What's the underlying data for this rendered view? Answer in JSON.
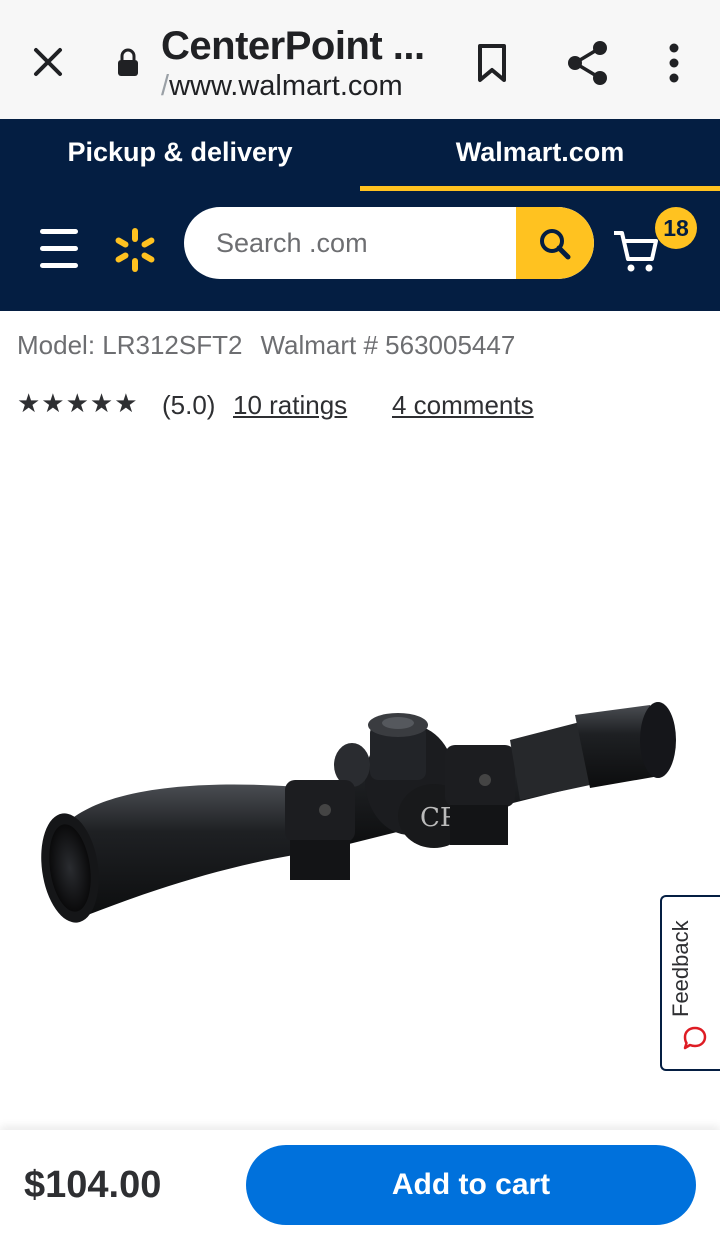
{
  "browser": {
    "title": "CenterPoint ...",
    "url_prefix": "/",
    "url": "www.walmart.com",
    "icons": [
      "close-icon",
      "lock-icon",
      "bookmark-icon",
      "share-icon",
      "more-vert-icon"
    ]
  },
  "tabs": [
    {
      "label": "Pickup & delivery",
      "active": false
    },
    {
      "label": "Walmart.com",
      "active": true
    }
  ],
  "header": {
    "search_placeholder": "Search .com",
    "cart_count": "18",
    "icons": [
      "menu-icon",
      "walmart-spark-icon",
      "search-icon",
      "cart-icon"
    ]
  },
  "product": {
    "model": "Model: LR312SFT2",
    "walmart_number": "Walmart # 563005447",
    "stars": "★★★★★",
    "score": "(5.0)",
    "ratings_link": "10 ratings",
    "comments_link": "4 comments",
    "price": "$104.00",
    "add_to_cart_label": "Add to cart"
  },
  "feedback": {
    "label": "Feedback"
  },
  "colors": {
    "navy": "#041e42",
    "yellow": "#ffc220",
    "blue": "#0071dc"
  }
}
